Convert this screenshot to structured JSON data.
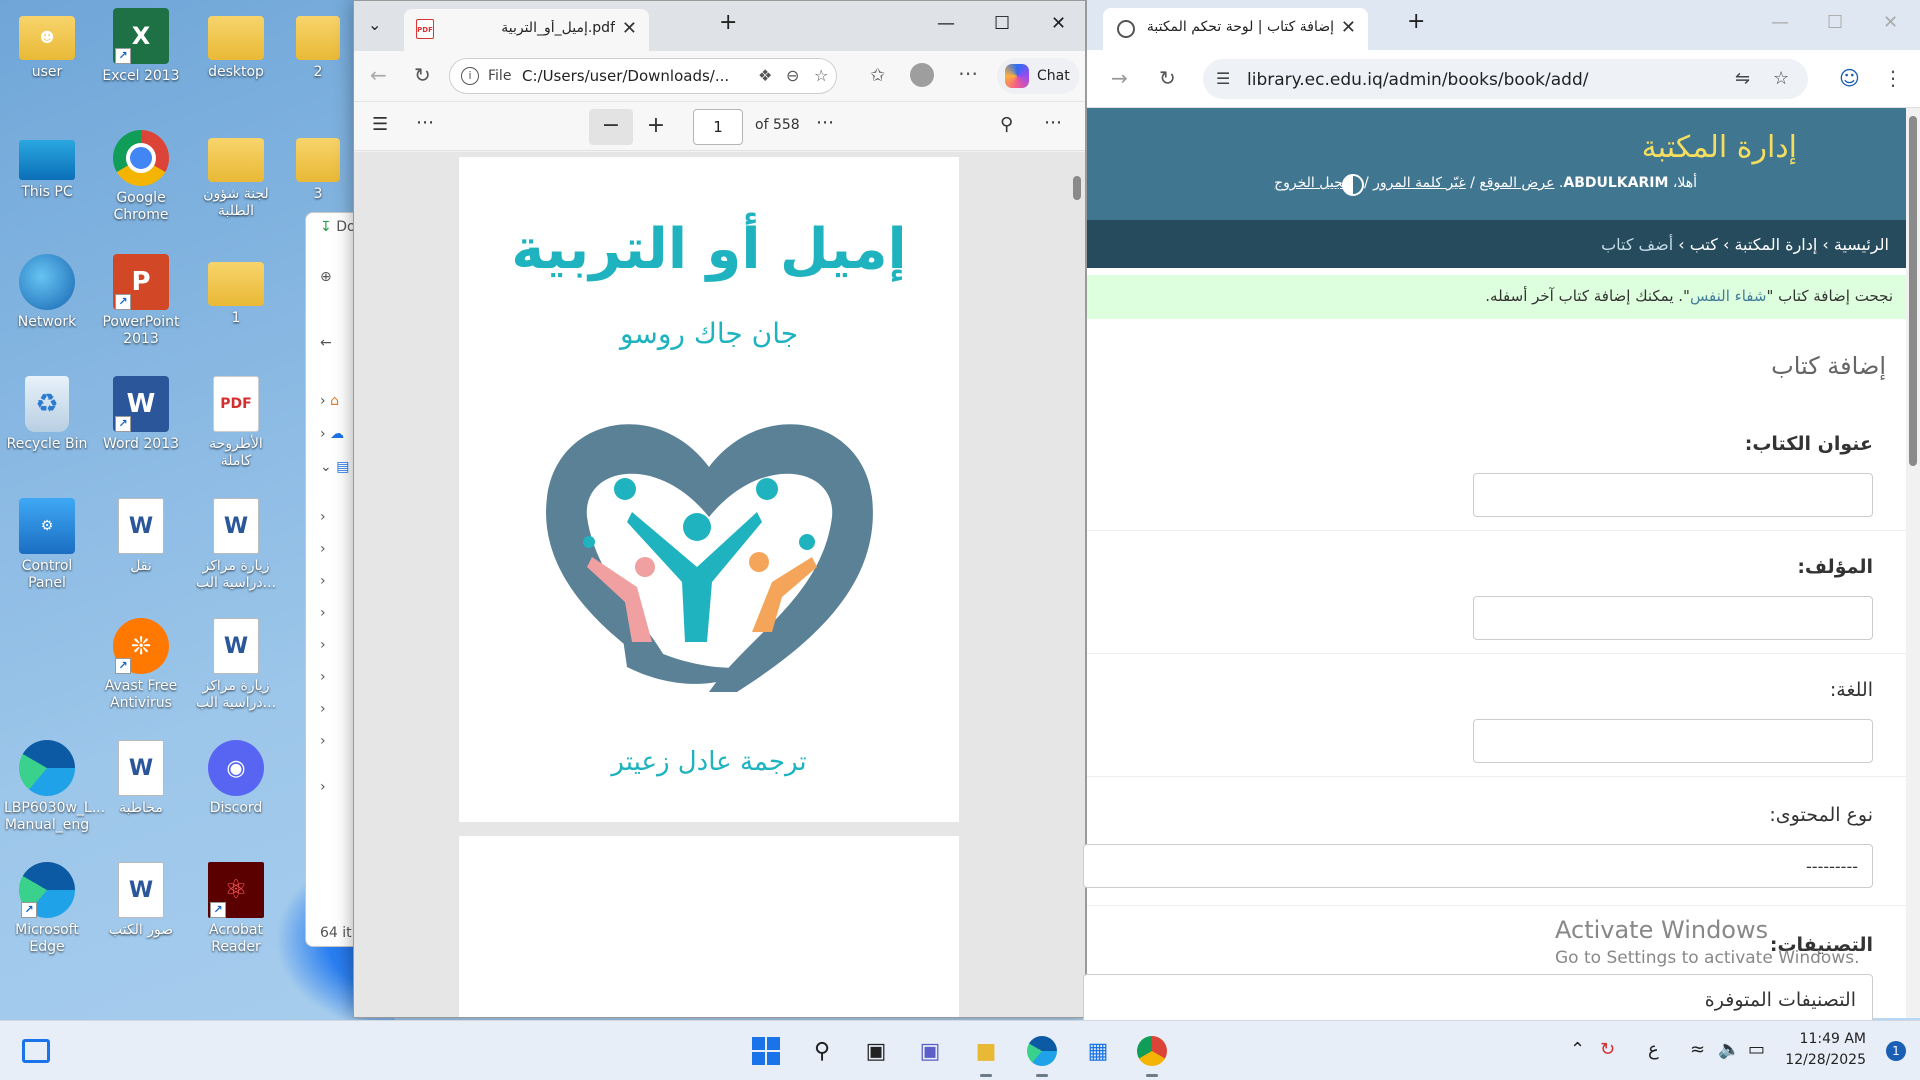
{
  "desktop": {
    "icons": [
      {
        "label": "user",
        "icon": "user-folder-icon"
      },
      {
        "label": "Excel 2013",
        "icon": "excel-icon"
      },
      {
        "label": "desktop",
        "icon": "folder-icon"
      },
      {
        "label": "2",
        "icon": "folder-icon"
      },
      {
        "label": "This PC",
        "icon": "monitor-icon"
      },
      {
        "label": "Google Chrome",
        "icon": "chrome-icon"
      },
      {
        "label": "لجنة شؤون الطلبة",
        "icon": "folder-icon"
      },
      {
        "label": "3",
        "icon": "folder-icon"
      },
      {
        "label": "Network",
        "icon": "network-icon"
      },
      {
        "label": "PowerPoint 2013",
        "icon": "powerpoint-icon"
      },
      {
        "label": "1",
        "icon": "folder-icon"
      },
      {
        "label": "Recycle Bin",
        "icon": "recycle-bin-icon"
      },
      {
        "label": "Word 2013",
        "icon": "word-icon"
      },
      {
        "label": "الأطروحة كاملة",
        "icon": "pdf-file-icon"
      },
      {
        "label": "Control Panel",
        "icon": "control-panel-icon"
      },
      {
        "label": "نقل",
        "icon": "word-doc-icon"
      },
      {
        "label": "زيارة مراكز دراسية الب...",
        "icon": "word-doc-icon"
      },
      {
        "label": "Avast Free Antivirus",
        "icon": "avast-icon"
      },
      {
        "label": "زيارة مراكز دراسية الب...",
        "icon": "word-doc-icon"
      },
      {
        "label": "LBP6030w_L... Manual_eng",
        "icon": "edge-pdf-icon"
      },
      {
        "label": "مخاطبة",
        "icon": "word-doc-icon"
      },
      {
        "label": "Discord",
        "icon": "discord-icon"
      },
      {
        "label": "Microsoft Edge",
        "icon": "edge-icon"
      },
      {
        "label": "صور الكتب",
        "icon": "word-doc-icon"
      },
      {
        "label": "Acrobat Reader",
        "icon": "acrobat-icon"
      }
    ]
  },
  "explorer": {
    "tab_label": "Do",
    "status": "64 it"
  },
  "pdf_window": {
    "tab_title": "إميل_أو_التربية.pdf",
    "file_label": "File",
    "url": "C:/Users/user/Downloads/...",
    "chat_label": "Chat",
    "page_number": "1",
    "page_count": "of 558",
    "book": {
      "title": "إميل أو التربية",
      "author": "جان جاك روسو",
      "translator": "ترجمة عادل زعيتر"
    },
    "colors": {
      "accent": "#1fb3bf",
      "logo_dark": "#5a8196",
      "pink": "#f0a0a0",
      "orange": "#f5a55a"
    }
  },
  "chrome_window": {
    "tab_title": "إضافة كتاب | لوحة تحكم المكتبة",
    "url": "library.ec.edu.iq/admin/books/book/add/",
    "header": {
      "site_name": "إدارة المكتبة",
      "welcome": "أهلا،",
      "username": "ABDULKARIM",
      "view_site": "عرض الموقع",
      "change_password": "غيّر كلمة المرور",
      "logout": "تسجيل الخروج"
    },
    "breadcrumbs": {
      "home": "الرئيسية",
      "app": "إدارة المكتبة",
      "model": "كتب",
      "current": "أضف كتاب"
    },
    "message": {
      "before": "نجحت إضافة كتاب \"",
      "link": "شفاء النفس",
      "after": "\". يمكنك إضافة كتاب آخر أسفله."
    },
    "form": {
      "title": "إضافة كتاب",
      "fields": [
        {
          "label": "عنوان الكتاب:",
          "required": true,
          "kind": "text"
        },
        {
          "label": "المؤلف:",
          "required": true,
          "kind": "text"
        },
        {
          "label": "اللغة:",
          "required": false,
          "kind": "text"
        },
        {
          "label": "نوع المحتوى:",
          "required": false,
          "kind": "select",
          "value": "---------"
        },
        {
          "label": "التصنيفات:",
          "required": true,
          "kind": "box",
          "value": "التصنيفات المتوفرة"
        }
      ]
    },
    "watermark": {
      "line1": "Activate Windows",
      "line2": "Go to Settings to activate Windows."
    },
    "colors": {
      "header": "#417690",
      "breadcrumbs": "#264b5d",
      "site_name": "#f5dd5d",
      "success": "#ddffdd"
    }
  },
  "taskbar": {
    "lang": "ع",
    "time": "11:49 AM",
    "date": "12/28/2025",
    "notifications": "1"
  }
}
